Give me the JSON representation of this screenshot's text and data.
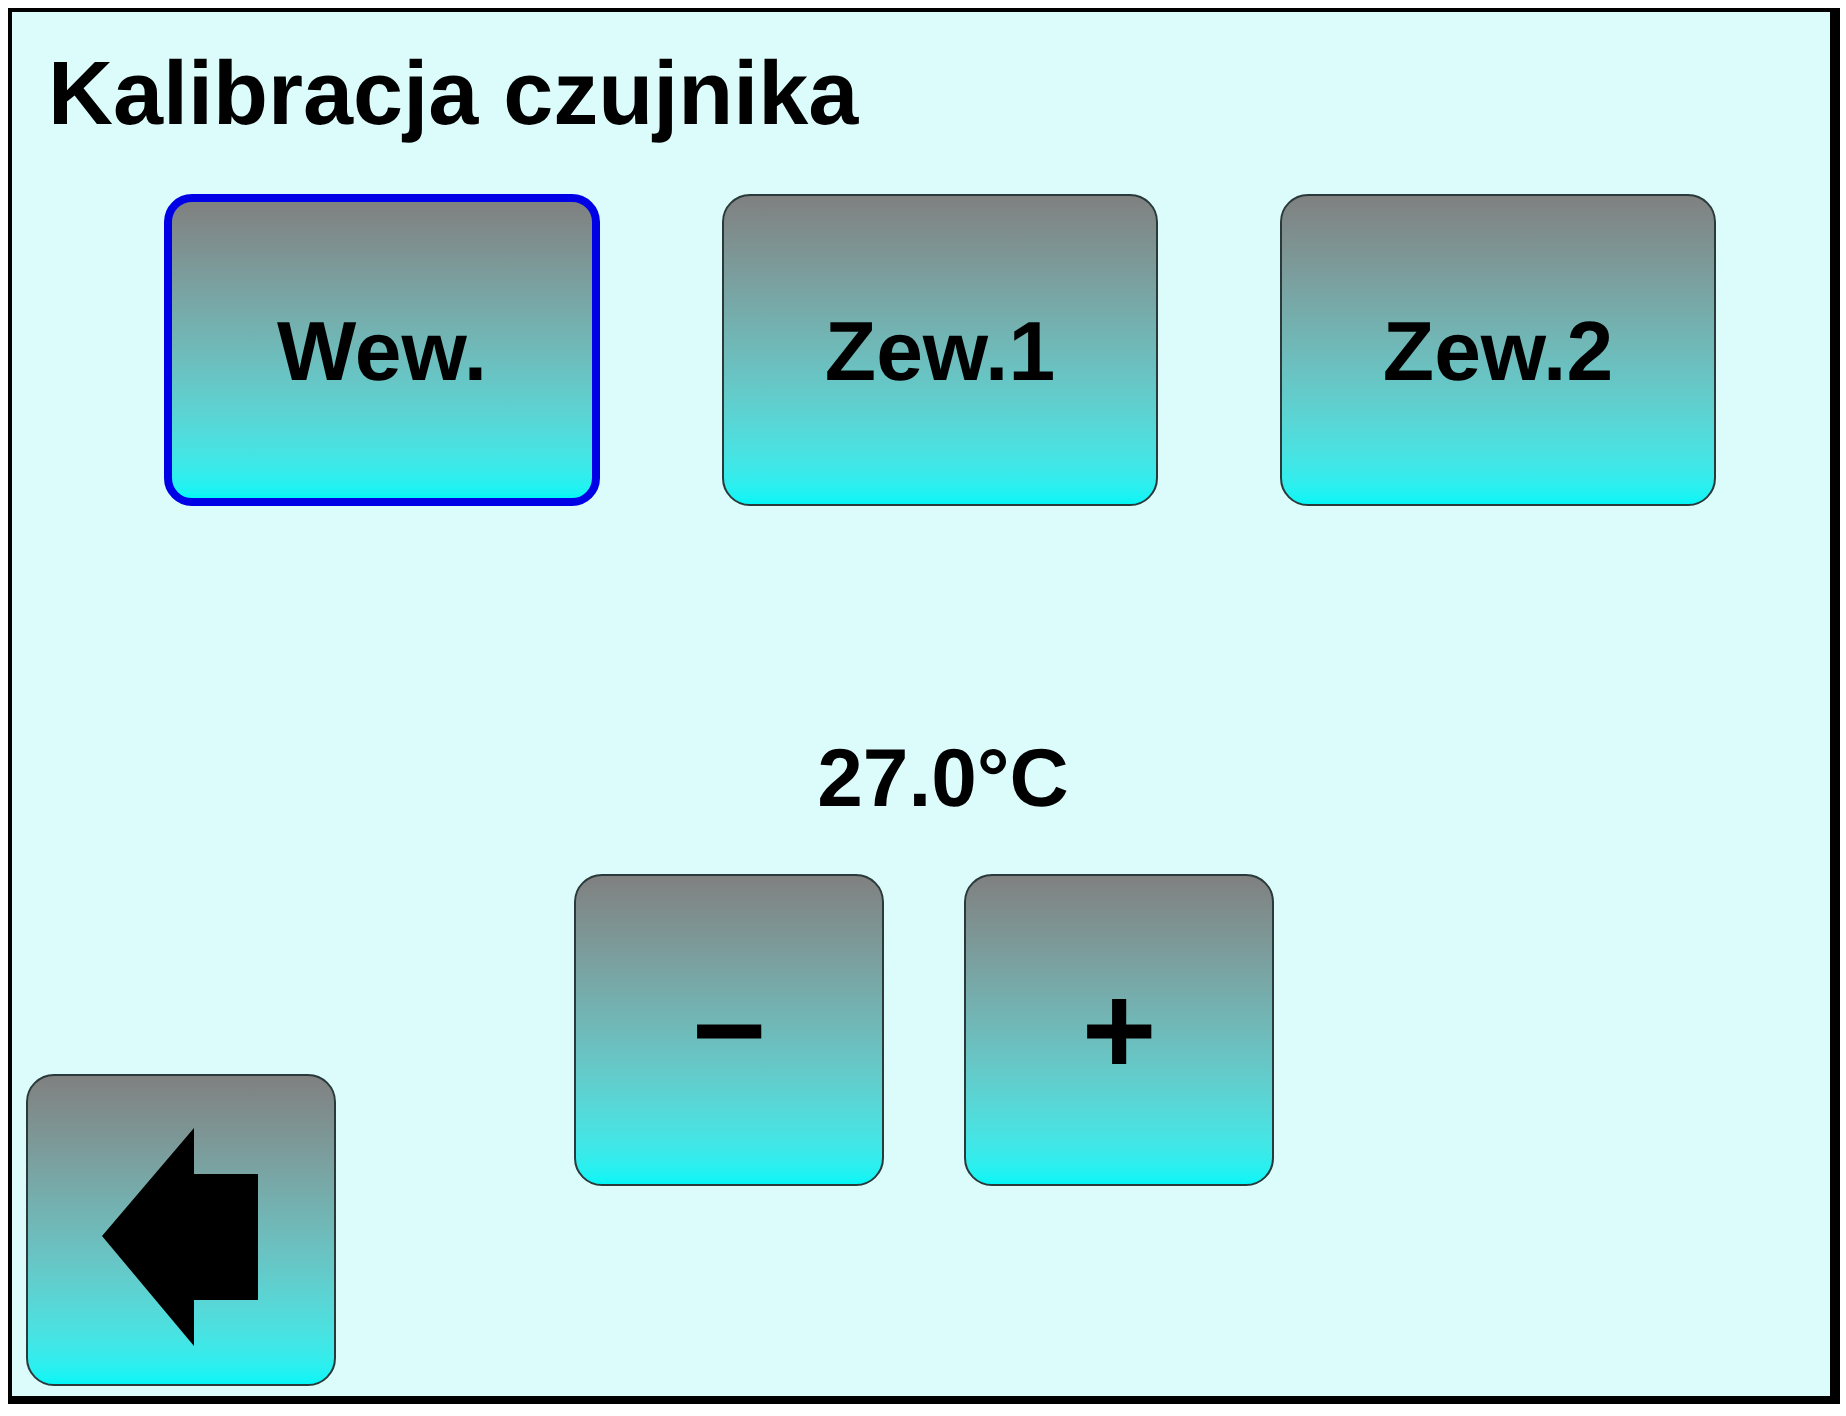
{
  "title": "Kalibracja czujnika",
  "sensor_tabs": [
    {
      "label": "Wew.",
      "selected": true
    },
    {
      "label": "Zew.1",
      "selected": false
    },
    {
      "label": "Zew.2",
      "selected": false
    }
  ],
  "reading": "27.0°C",
  "adjust_buttons": [
    "−",
    "+"
  ]
}
